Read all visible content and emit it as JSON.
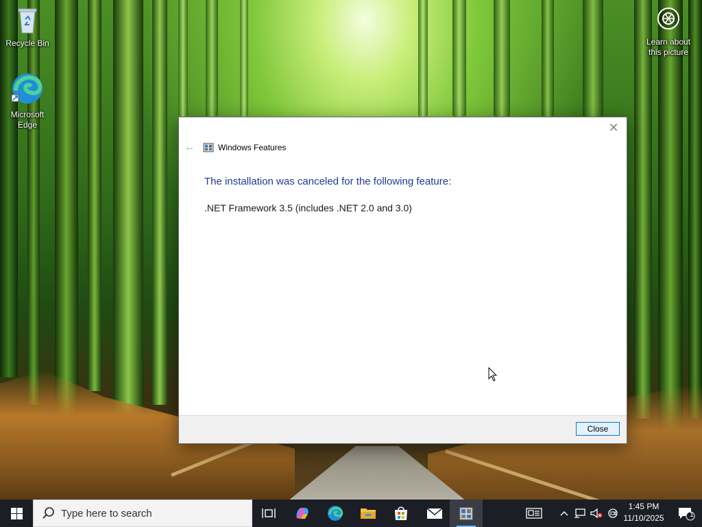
{
  "desktop": {
    "icons": [
      {
        "label": "Recycle Bin",
        "icon": "recycle-bin-icon"
      },
      {
        "label": "Microsoft Edge",
        "icon": "edge-icon"
      }
    ],
    "spotlight_label": "Learn about this picture"
  },
  "dialog": {
    "title": "Windows Features",
    "heading": "The installation was canceled for the following feature:",
    "feature_name": ".NET Framework 3.5 (includes .NET 2.0 and 3.0)",
    "close_button": "Close",
    "heading_color": "#1f3a93"
  },
  "taskbar": {
    "search_placeholder": "Type here to search",
    "pinned": [
      "task-view-icon",
      "copilot-icon",
      "edge-icon",
      "file-explorer-icon",
      "microsoft-store-icon",
      "mail-icon",
      "windows-features-icon"
    ],
    "active_app": "windows-features-icon",
    "tray": [
      "news-widget-icon",
      "chevron-up-icon",
      "network-icon",
      "volume-muted-icon",
      "meet-now-icon"
    ],
    "time": "1:45 PM",
    "date": "11/10/2025",
    "notification_count": "1"
  }
}
